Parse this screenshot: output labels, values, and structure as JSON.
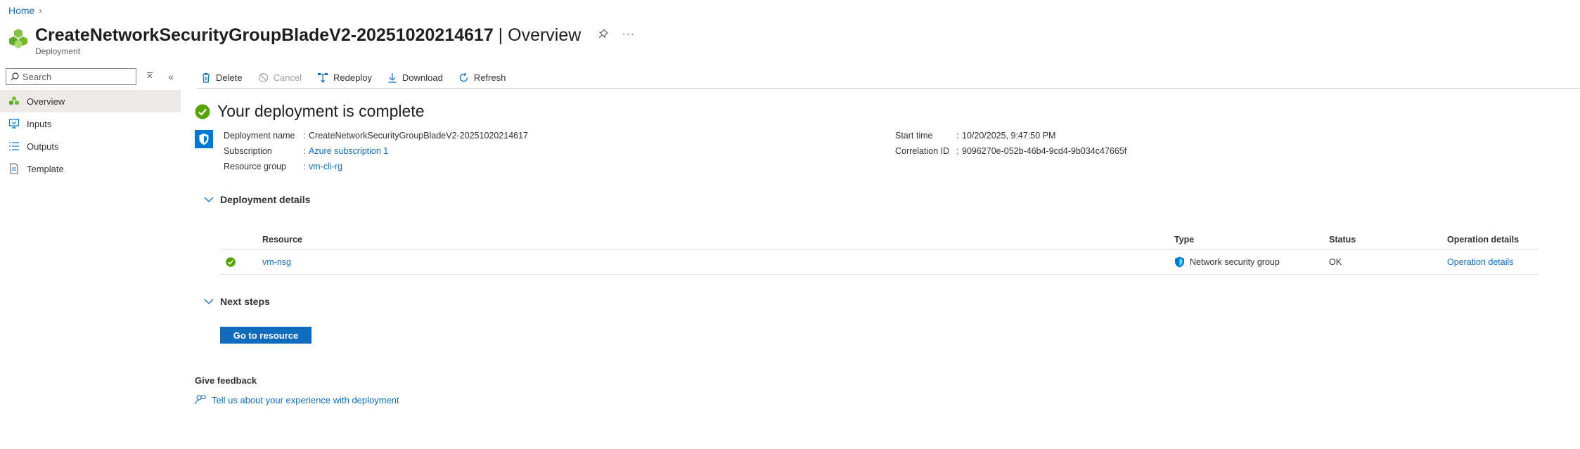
{
  "breadcrumb": {
    "home": "Home"
  },
  "header": {
    "name": "CreateNetworkSecurityGroupBladeV2-20251020214617",
    "section": " | Overview",
    "subtitle": "Deployment"
  },
  "search": {
    "placeholder": "Search",
    "value": ""
  },
  "nav": {
    "items": [
      {
        "label": "Overview",
        "icon": "deployment-icon",
        "active": true
      },
      {
        "label": "Inputs",
        "icon": "inputs-icon",
        "active": false
      },
      {
        "label": "Outputs",
        "icon": "outputs-icon",
        "active": false
      },
      {
        "label": "Template",
        "icon": "template-icon",
        "active": false
      }
    ]
  },
  "toolbar": {
    "delete": "Delete",
    "cancel": "Cancel",
    "redeploy": "Redeploy",
    "download": "Download",
    "refresh": "Refresh"
  },
  "status": {
    "title": "Your deployment is complete"
  },
  "summary": {
    "deployment_name_label": "Deployment name",
    "deployment_name": "CreateNetworkSecurityGroupBladeV2-20251020214617",
    "subscription_label": "Subscription",
    "subscription": "Azure subscription 1",
    "resource_group_label": "Resource group",
    "resource_group": "vm-cli-rg",
    "start_time_label": "Start time",
    "start_time": "10/20/2025, 9:47:50 PM",
    "correlation_label": "Correlation ID",
    "correlation_id": "9096270e-052b-46b4-9cd4-9b034c47665f",
    "colon": ":"
  },
  "deployment_details": {
    "title": "Deployment details",
    "columns": {
      "resource": "Resource",
      "type": "Type",
      "status": "Status",
      "operation": "Operation details"
    },
    "rows": [
      {
        "resource": "vm-nsg",
        "type": "Network security group",
        "status": "OK",
        "operation": "Operation details"
      }
    ]
  },
  "next_steps": {
    "title": "Next steps",
    "button": "Go to resource"
  },
  "feedback": {
    "title": "Give feedback",
    "link": "Tell us about your experience with deployment"
  },
  "colors": {
    "accent": "#0f6cbd",
    "success": "#57a300",
    "nav_active": "#edebe9"
  }
}
